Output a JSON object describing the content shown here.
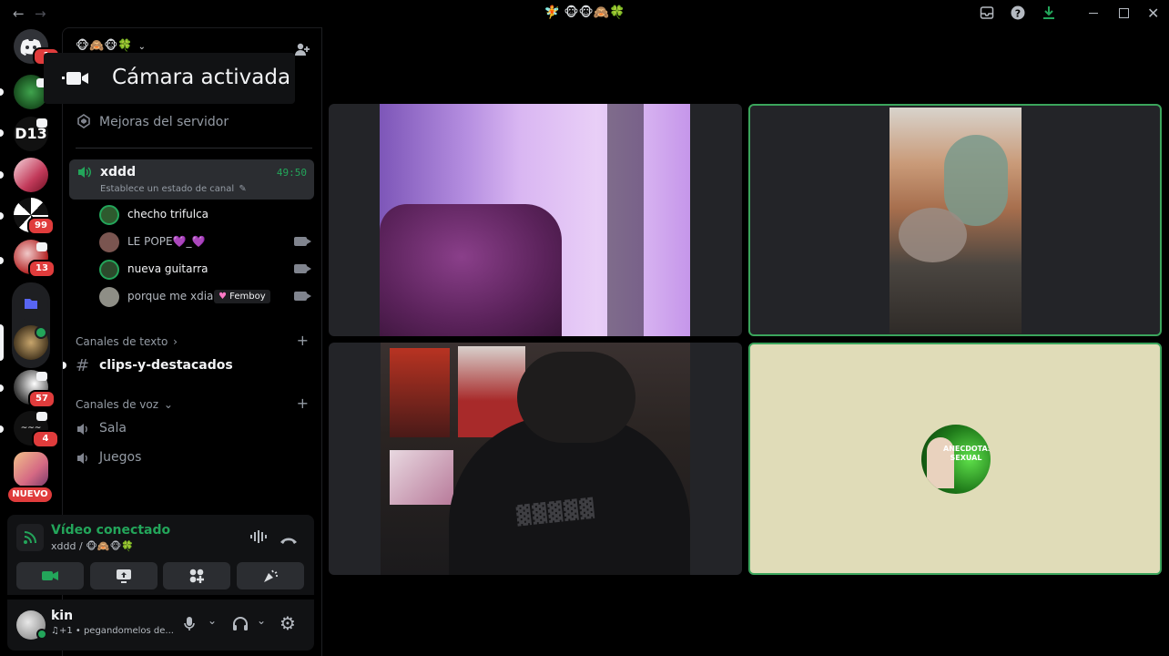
{
  "titlebar": {
    "back_glyph": "←",
    "forward_glyph": "→",
    "title": "🧚 🐵🐵🙈🍀",
    "inbox_icon": "inbox-icon",
    "help_icon": "help-icon",
    "download_icon": "download-icon"
  },
  "toast": {
    "text": "Cámara activada"
  },
  "server_header": {
    "name": "🐵🙈🐵🍀"
  },
  "server_rail": {
    "badges": [
      "1",
      "99",
      "13",
      "57",
      "4"
    ],
    "new_label": "NUEVO",
    "d13_text": "D13"
  },
  "sidebar": {
    "boost": "Mejoras del servidor",
    "active_channel": {
      "name": "xddd",
      "time": "49:50",
      "status": "Establece un estado de canal"
    },
    "voice_users": [
      {
        "name": "checho trifulca",
        "color": "#2e5a2e"
      },
      {
        "name": "LE POPE💜_💜",
        "color": "#7a5550"
      },
      {
        "name": "nueva guitarra",
        "color": "#2c4a2c"
      },
      {
        "name": "porque me xdiai",
        "tag": "Femboy",
        "color": "#8e8e86"
      }
    ],
    "text_category": "Canales de texto",
    "text_channels": [
      {
        "name": "clips-y-destacados"
      }
    ],
    "voice_category": "Canales de voz",
    "voice_channels": [
      {
        "name": "Sala"
      },
      {
        "name": "Juegos"
      }
    ]
  },
  "voice_panel": {
    "status": "Vídeo conectado",
    "location": "xddd / 🐵🙈🐵🍀"
  },
  "user_panel": {
    "username": "kin",
    "status": "♫+1 • pegandomelos de..."
  },
  "video_tiles": [
    {
      "name": "webcam-purple-room"
    },
    {
      "name": "webcam-person-upside-down"
    },
    {
      "name": "webcam-person-dark-shirt"
    },
    {
      "name": "avatar-anecdotas",
      "avatar_text": "ANECDOTAS SEXUAL"
    }
  ],
  "colors": {
    "accent_green": "#23a55a",
    "badge_red": "#e03c3c",
    "blurple": "#5865f2",
    "sand": "#e0dcb8"
  }
}
